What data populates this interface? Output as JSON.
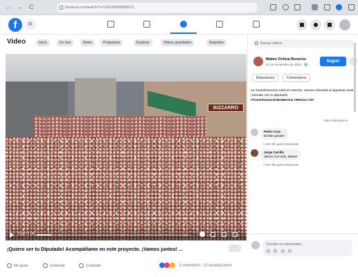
{
  "browser": {
    "address": "facebook.com/watch/?v=1081445588809013",
    "nav": {
      "back": "←",
      "forward": "→",
      "reload": "C"
    }
  },
  "header": {
    "logo": "f"
  },
  "video_page": {
    "title": "Video",
    "pills": [
      "Inicio",
      "En vivo",
      "Reels",
      "Programas",
      "Explorar",
      "Videos guardados",
      "Seguidos"
    ]
  },
  "video": {
    "time": "0:08 / 1:08",
    "progress": 0.1,
    "sign_text": "BIZZARRO"
  },
  "post": {
    "caption": "¡Quiero ser tu Diputado! Acompáñame en este proyecto. ¡Vamos juntos! ...",
    "more": "···",
    "actions": [
      "Me gusta",
      "Comentar",
      "Compartir"
    ],
    "reactions_text": "3 comentarios · 10 visualizaciones"
  },
  "side": {
    "search_placeholder": "Buscar videos",
    "page_name": "Mateo Ochoa Roseros",
    "page_meta": "21 de noviembre de 2023 · 🌐",
    "follow_label": "Seguir",
    "tabs": [
      "Reacciones",
      "Comentarios"
    ],
    "post_text": "La Transformación está en marcha, vamos a llevarla al siguiente nivel.",
    "post_text2": "¡Súmate con tu diputado!",
    "hashtag": "#TransformaciónEnMarcha #Mexico #4T",
    "more_relevant": "Más relevantes ▾",
    "comments": [
      {
        "name": "Pedro Cruz",
        "text": "Echale ganas!!",
        "meta": "1 sem   Me gusta   Responder"
      },
      {
        "name": "Jorge Carrillo",
        "text": "Vamos con todo, Mateo!",
        "meta": "1 sem   Me gusta   Responder"
      }
    ],
    "comment_placeholder": "Escribe un comentario..."
  },
  "colors": {
    "accent": "#1877f2",
    "chrome": "#dfe3e8"
  }
}
